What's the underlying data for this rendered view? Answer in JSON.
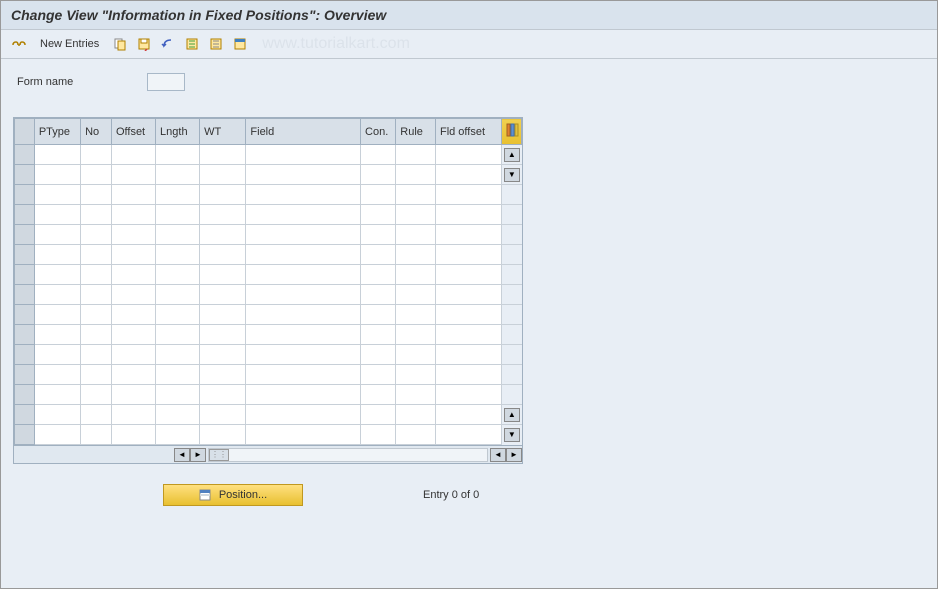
{
  "title": "Change View \"Information in Fixed Positions\": Overview",
  "toolbar": {
    "new_entries_label": "New Entries"
  },
  "watermark": "www.tutorialkart.com",
  "form": {
    "name_label": "Form name",
    "name_value": ""
  },
  "table": {
    "columns": {
      "ptype": "PType",
      "no": "No",
      "offset": "Offset",
      "length": "Lngth",
      "wt": "WT",
      "field": "Field",
      "con": "Con.",
      "rule": "Rule",
      "fld_offset": "Fld offset"
    },
    "rows": []
  },
  "position_btn": "Position...",
  "entry_status": "Entry 0 of 0"
}
